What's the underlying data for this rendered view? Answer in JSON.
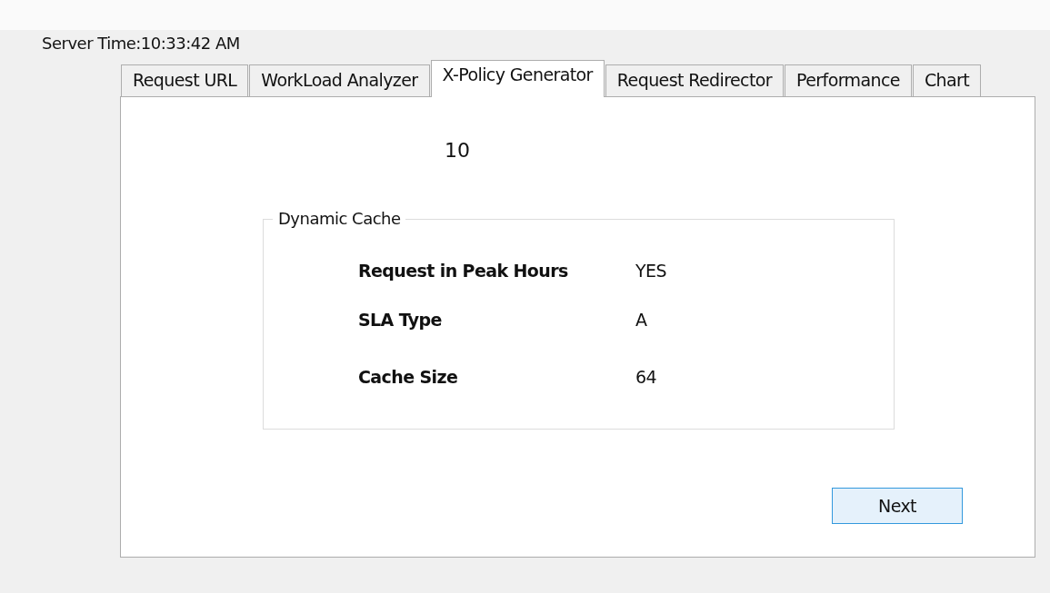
{
  "server_time": "Server Time:10:33:42 AM",
  "tabs": [
    {
      "label": "Request URL",
      "selected": false
    },
    {
      "label": "WorkLoad Analyzer",
      "selected": false
    },
    {
      "label": "X-Policy Generator",
      "selected": true
    },
    {
      "label": "Request Redirector",
      "selected": false
    },
    {
      "label": "Performance",
      "selected": false
    },
    {
      "label": "Chart",
      "selected": false
    }
  ],
  "counter": "10",
  "group": {
    "title": "Dynamic Cache",
    "rows": [
      {
        "label": "Request in Peak Hours",
        "value": "YES"
      },
      {
        "label": "SLA Type",
        "value": "A"
      },
      {
        "label": "Cache Size",
        "value": "64"
      }
    ]
  },
  "buttons": [
    {
      "label": "Next"
    }
  ]
}
